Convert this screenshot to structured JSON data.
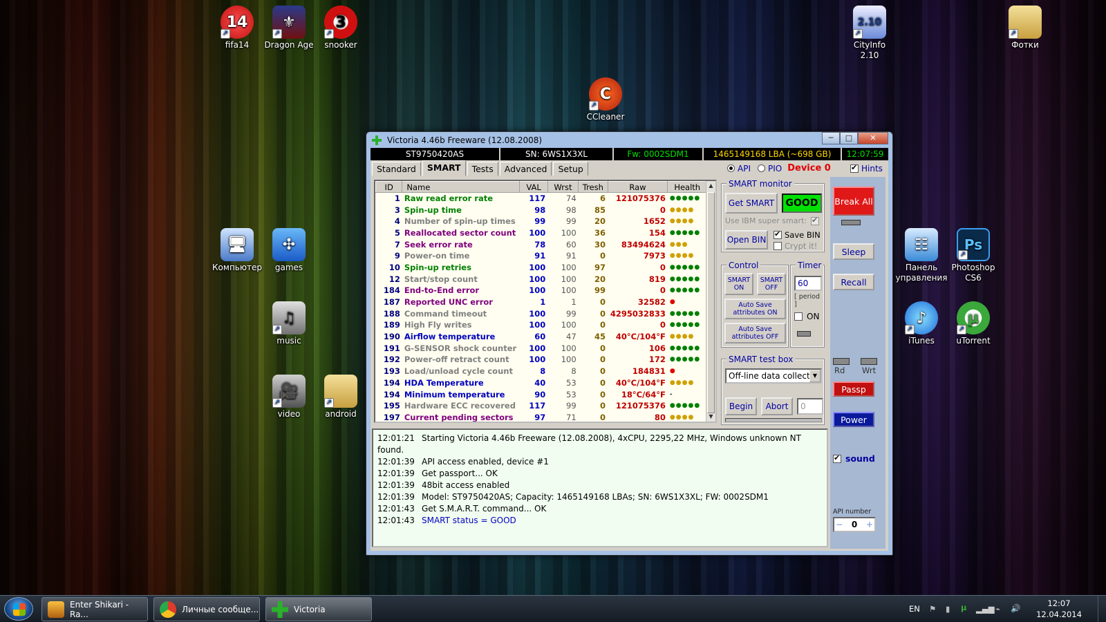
{
  "desktop": {
    "icons": [
      {
        "label": "fifa14"
      },
      {
        "label": "Dragon Age"
      },
      {
        "label": "snooker"
      },
      {
        "label": "CCleaner"
      },
      {
        "label": "CityInfo 2.10"
      },
      {
        "label": "Фотки"
      },
      {
        "label": "Компьютер"
      },
      {
        "label": "games"
      },
      {
        "label": "music"
      },
      {
        "label": "video"
      },
      {
        "label": "android"
      },
      {
        "label": "Панель управления"
      },
      {
        "label": "Photoshop CS6"
      },
      {
        "label": "iTunes"
      },
      {
        "label": "uTorrent"
      }
    ]
  },
  "window": {
    "title": "Victoria 4.46b Freeware (12.08.2008)",
    "controls": {
      "min": "─",
      "max": "□",
      "close": "✕"
    }
  },
  "infobar": {
    "model": "ST9750420AS",
    "serial": "SN: 6WS1X3XL",
    "firmware": "Fw: 0002SDM1",
    "capacity": "1465149168 LBA (~698 GB)",
    "clock": "12:07:59"
  },
  "tabs": [
    "Standard",
    "SMART",
    "Tests",
    "Advanced",
    "Setup"
  ],
  "mode": {
    "api": "API",
    "pio": "PIO",
    "device": "Device 0",
    "hints": "Hints"
  },
  "smart_table": {
    "columns": [
      "ID",
      "Name",
      "VAL",
      "Wrst",
      "Tresh",
      "Raw",
      "Health"
    ],
    "rows": [
      {
        "id": "1",
        "name": "Raw read error rate",
        "val": "117",
        "wrst": "74",
        "tresh": "6",
        "raw": "121075376",
        "health": "●●●●●",
        "color": "#008000",
        "hcolor": "#008000"
      },
      {
        "id": "3",
        "name": "Spin-up time",
        "val": "98",
        "wrst": "98",
        "tresh": "85",
        "raw": "0",
        "health": "●●●●",
        "color": "#008000",
        "hcolor": "#d0a000"
      },
      {
        "id": "4",
        "name": "Number of spin-up times",
        "val": "99",
        "wrst": "99",
        "tresh": "20",
        "raw": "1652",
        "health": "●●●●",
        "color": "#808080",
        "hcolor": "#d0a000"
      },
      {
        "id": "5",
        "name": "Reallocated sector count",
        "val": "100",
        "wrst": "100",
        "tresh": "36",
        "raw": "154",
        "health": "●●●●●",
        "color": "#800080",
        "hcolor": "#008000"
      },
      {
        "id": "7",
        "name": "Seek error rate",
        "val": "78",
        "wrst": "60",
        "tresh": "30",
        "raw": "83494624",
        "health": "●●●",
        "color": "#800080",
        "hcolor": "#d0a000"
      },
      {
        "id": "9",
        "name": "Power-on time",
        "val": "91",
        "wrst": "91",
        "tresh": "0",
        "raw": "7973",
        "health": "●●●●",
        "color": "#808080",
        "hcolor": "#d0a000"
      },
      {
        "id": "10",
        "name": "Spin-up retries",
        "val": "100",
        "wrst": "100",
        "tresh": "97",
        "raw": "0",
        "health": "●●●●●",
        "color": "#008000",
        "hcolor": "#008000"
      },
      {
        "id": "12",
        "name": "Start/stop count",
        "val": "100",
        "wrst": "100",
        "tresh": "20",
        "raw": "819",
        "health": "●●●●●",
        "color": "#808080",
        "hcolor": "#008000"
      },
      {
        "id": "184",
        "name": "End-to-End error",
        "val": "100",
        "wrst": "100",
        "tresh": "99",
        "raw": "0",
        "health": "●●●●●",
        "color": "#800080",
        "hcolor": "#008000"
      },
      {
        "id": "187",
        "name": "Reported UNC error",
        "val": "1",
        "wrst": "1",
        "tresh": "0",
        "raw": "32582",
        "health": "●",
        "color": "#800080",
        "hcolor": "#e00000"
      },
      {
        "id": "188",
        "name": "Command timeout",
        "val": "100",
        "wrst": "99",
        "tresh": "0",
        "raw": "4295032833",
        "health": "●●●●●",
        "color": "#808080",
        "hcolor": "#008000"
      },
      {
        "id": "189",
        "name": "High Fly writes",
        "val": "100",
        "wrst": "100",
        "tresh": "0",
        "raw": "0",
        "health": "●●●●●",
        "color": "#808080",
        "hcolor": "#008000"
      },
      {
        "id": "190",
        "name": "Airflow temperature",
        "val": "60",
        "wrst": "47",
        "tresh": "45",
        "raw": "40°C/104°F",
        "health": "●●●●",
        "color": "#0000c0",
        "hcolor": "#d0a000"
      },
      {
        "id": "191",
        "name": "G-SENSOR shock counter",
        "val": "100",
        "wrst": "100",
        "tresh": "0",
        "raw": "106",
        "health": "●●●●●",
        "color": "#808080",
        "hcolor": "#008000"
      },
      {
        "id": "192",
        "name": "Power-off retract count",
        "val": "100",
        "wrst": "100",
        "tresh": "0",
        "raw": "172",
        "health": "●●●●●",
        "color": "#808080",
        "hcolor": "#008000"
      },
      {
        "id": "193",
        "name": "Load/unload cycle count",
        "val": "8",
        "wrst": "8",
        "tresh": "0",
        "raw": "184831",
        "health": "●",
        "color": "#808080",
        "hcolor": "#e00000"
      },
      {
        "id": "194",
        "name": "HDA Temperature",
        "val": "40",
        "wrst": "53",
        "tresh": "0",
        "raw": "40°C/104°F",
        "health": "●●●●",
        "color": "#0000c0",
        "hcolor": "#d0a000"
      },
      {
        "id": "194",
        "name": "Minimum temperature",
        "val": "90",
        "wrst": "53",
        "tresh": "0",
        "raw": "18°C/64°F",
        "health": "-",
        "color": "#0000c0",
        "hcolor": "#333"
      },
      {
        "id": "195",
        "name": "Hardware ECC recovered",
        "val": "117",
        "wrst": "99",
        "tresh": "0",
        "raw": "121075376",
        "health": "●●●●●",
        "color": "#808080",
        "hcolor": "#008000"
      },
      {
        "id": "197",
        "name": "Current pending sectors",
        "val": "97",
        "wrst": "71",
        "tresh": "0",
        "raw": "80",
        "health": "●●●●",
        "color": "#800080",
        "hcolor": "#d0a000"
      }
    ]
  },
  "smart_monitor": {
    "title": "SMART monitor",
    "get_smart": "Get SMART",
    "status": "GOOD",
    "ibm": "Use IBM super smart:",
    "open_bin": "Open BIN",
    "save_bin": "Save BIN",
    "crypt": "Crypt it!"
  },
  "control": {
    "title": "Control",
    "smart_on": "SMART ON",
    "smart_off": "SMART OFF",
    "autosave_on": "Auto Save attributes ON",
    "autosave_off": "Auto Save attributes OFF"
  },
  "timer": {
    "title": "Timer",
    "value": "60",
    "period": "[ period ]",
    "on": "ON"
  },
  "testbox": {
    "title": "SMART test box",
    "selected": "Off-line data collect",
    "begin": "Begin",
    "abort": "Abort",
    "value": "0"
  },
  "side": {
    "break_all": "Break All",
    "sleep": "Sleep",
    "recall": "Recall",
    "rd": "Rd",
    "wrt": "Wrt",
    "passp": "Passp",
    "power": "Power",
    "sound": "sound",
    "api_number_label": "API number",
    "api_number": "0"
  },
  "log": [
    {
      "time": "12:01:21",
      "msg": "Starting Victoria 4.46b Freeware (12.08.2008), 4xCPU, 2295,22 MHz, Windows unknown NT found."
    },
    {
      "time": "12:01:39",
      "msg": "API access enabled, device #1"
    },
    {
      "time": "12:01:39",
      "msg": "Get passport... OK"
    },
    {
      "time": "12:01:39",
      "msg": "48bit access enabled"
    },
    {
      "time": "12:01:39",
      "msg": "Model: ST9750420AS; Capacity: 1465149168 LBAs; SN: 6WS1X3XL; FW: 0002SDM1"
    },
    {
      "time": "12:01:43",
      "msg": "Get S.M.A.R.T. command... OK"
    },
    {
      "time": "12:01:43",
      "msg": "SMART status = GOOD"
    }
  ],
  "taskbar": {
    "items": [
      {
        "label": "Enter Shikari - Ra..."
      },
      {
        "label": "Личные сообще..."
      },
      {
        "label": "Victoria"
      }
    ],
    "lang": "EN",
    "time": "12:07",
    "date": "12.04.2014"
  }
}
